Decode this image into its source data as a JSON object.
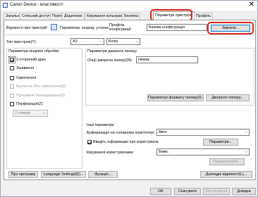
{
  "window": {
    "title": "Canon Device - властивості",
    "close_glyph": "✕"
  },
  "tabs": [
    {
      "label": "Загальні"
    },
    {
      "label": "Спільний доступ"
    },
    {
      "label": "Порти"
    },
    {
      "label": "Додатково"
    },
    {
      "label": "Керування кольорами"
    },
    {
      "label": "Безпека"
    },
    {
      "label": "Параметри пристрою"
    },
    {
      "label": "Профіль"
    }
  ],
  "top": {
    "view_label": "Відомості про пристрій:",
    "view_value": "Параметри, знаряд. устрою",
    "profile_label": "Профіль конфігурації:",
    "profile_value": "Базова конфігурація",
    "change_button": "Змінити..."
  },
  "device": {
    "type_label": "Тип пристрою(T):",
    "paper_value": "A3",
    "color_value": "Колір"
  },
  "finishing": {
    "title": "Параметри кінцевої обробки",
    "items": [
      {
        "label": "2-сторонній друк",
        "checked": true,
        "disabled": false
      },
      {
        "label": "Зшивання",
        "checked": false,
        "disabled": false
      },
      {
        "label": "Скріплення",
        "checked": false,
        "disabled": false
      },
      {
        "label": "Буклетна (без скріплення)(I)",
        "checked": false,
        "disabled": true
      },
      {
        "label": "Прошивне брошурування(I)",
        "checked": false,
        "disabled": true
      },
      {
        "label": "Перфорація(Z):",
        "checked": false,
        "disabled": false
      }
    ],
    "hole_value": "2 отвори"
  },
  "paper_source": {
    "title": "Параметри джерела паперу",
    "options_label": "Опції джерела паперу(N):",
    "options_value": "Немає",
    "format_button": "Параметри формату паперу(I)...",
    "source_button": "Джерело паперу..."
  },
  "other": {
    "title": "Інші параметри",
    "spool_label": "Буферизація на головному комп'ютері:",
    "spool_value": "Авто",
    "user_info_label": "Введіть інформацію про користувача",
    "user_info_checked": true,
    "params_button": "Параметри...",
    "user_mgmt_label": "Керування користувачами:",
    "user_mgmt_value": "Вимк.",
    "params2_button": "Параметри(H)..."
  },
  "bottom_buttons": {
    "about": "Про програму",
    "language": "Language Settings(E)...",
    "function": "Функція...",
    "device_info": "Докладні відомості(L)..."
  },
  "dialog_buttons": {
    "ok": "OK",
    "cancel": "Скасувати",
    "apply": "Застосувати",
    "help": "Довідка"
  }
}
